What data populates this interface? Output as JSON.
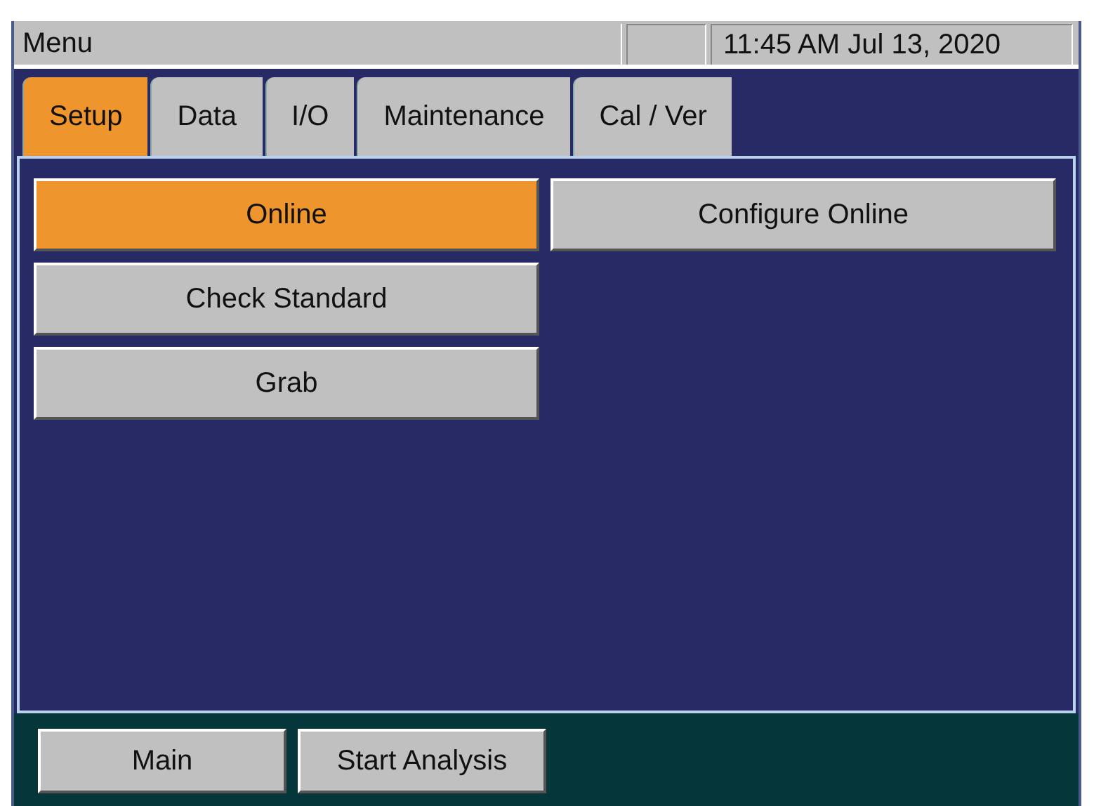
{
  "title_bar": {
    "title": "Menu",
    "datetime": "11:45 AM Jul 13, 2020"
  },
  "tabs": [
    {
      "label": "Setup",
      "selected": true
    },
    {
      "label": "Data",
      "selected": false
    },
    {
      "label": "I/O",
      "selected": false
    },
    {
      "label": "Maintenance",
      "selected": false
    },
    {
      "label": "Cal / Ver",
      "selected": false
    }
  ],
  "buttons": [
    {
      "label": "Online",
      "selected": true
    },
    {
      "label": "Configure Online",
      "selected": false
    },
    {
      "label": "Check Standard",
      "selected": false
    },
    {
      "label": "Grab",
      "selected": false
    }
  ],
  "footer_buttons": [
    "Main",
    "Start Analysis"
  ]
}
